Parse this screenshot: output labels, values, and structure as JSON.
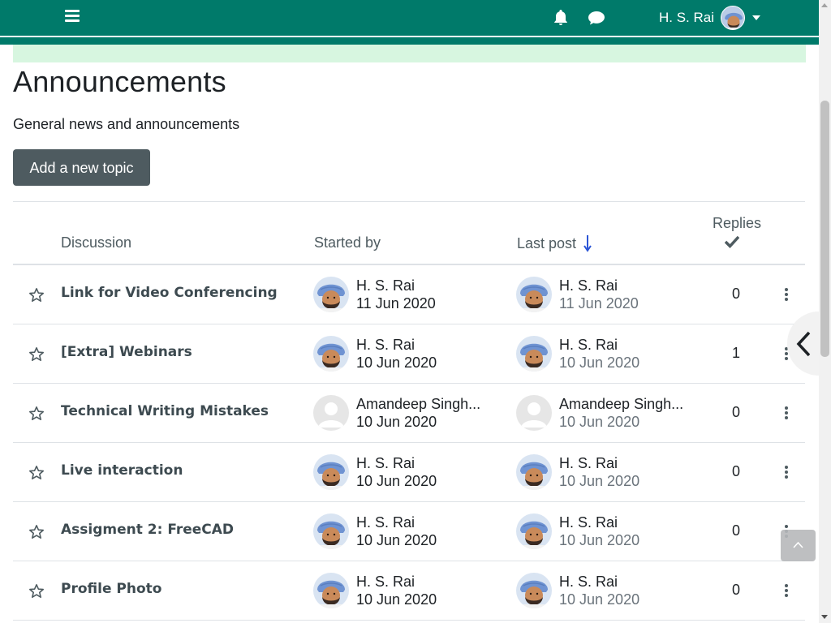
{
  "navbar": {
    "user_name": "H. S. Rai",
    "menu_icon": "hamburger-icon",
    "notifications_icon": "bell-icon",
    "messages_icon": "chat-bubble-icon",
    "brand_color": "#007a6a"
  },
  "page": {
    "title": "Announcements",
    "intro": "General news and announcements",
    "add_topic_label": "Add a new topic"
  },
  "table": {
    "headers": {
      "discussion": "Discussion",
      "started_by": "Started by",
      "last_post": "Last post",
      "replies": "Replies"
    },
    "rows": [
      {
        "topic": "Link for Video Conferencing",
        "started_name": "H. S. Rai",
        "started_date": "11 Jun 2020",
        "last_name": "H. S. Rai",
        "last_date": "11 Jun 2020",
        "replies": "0",
        "avatar": "user"
      },
      {
        "topic": "[Extra] Webinars",
        "started_name": "H. S. Rai",
        "started_date": "10 Jun 2020",
        "last_name": "H. S. Rai",
        "last_date": "10 Jun 2020",
        "replies": "1",
        "avatar": "user"
      },
      {
        "topic": "Technical Writing Mistakes",
        "started_name": "Amandeep Singh...",
        "started_date": "10 Jun 2020",
        "last_name": "Amandeep Singh...",
        "last_date": "10 Jun 2020",
        "replies": "0",
        "avatar": "default"
      },
      {
        "topic": "Live interaction",
        "started_name": "H. S. Rai",
        "started_date": "10 Jun 2020",
        "last_name": "H. S. Rai",
        "last_date": "10 Jun 2020",
        "replies": "0",
        "avatar": "user"
      },
      {
        "topic": "Assigment 2: FreeCAD",
        "started_name": "H. S. Rai",
        "started_date": "10 Jun 2020",
        "last_name": "H. S. Rai",
        "last_date": "10 Jun 2020",
        "replies": "0",
        "avatar": "user"
      },
      {
        "topic": "Profile Photo",
        "started_name": "H. S. Rai",
        "started_date": "10 Jun 2020",
        "last_name": "H. S. Rai",
        "last_date": "10 Jun 2020",
        "replies": "0",
        "avatar": "user"
      }
    ]
  }
}
